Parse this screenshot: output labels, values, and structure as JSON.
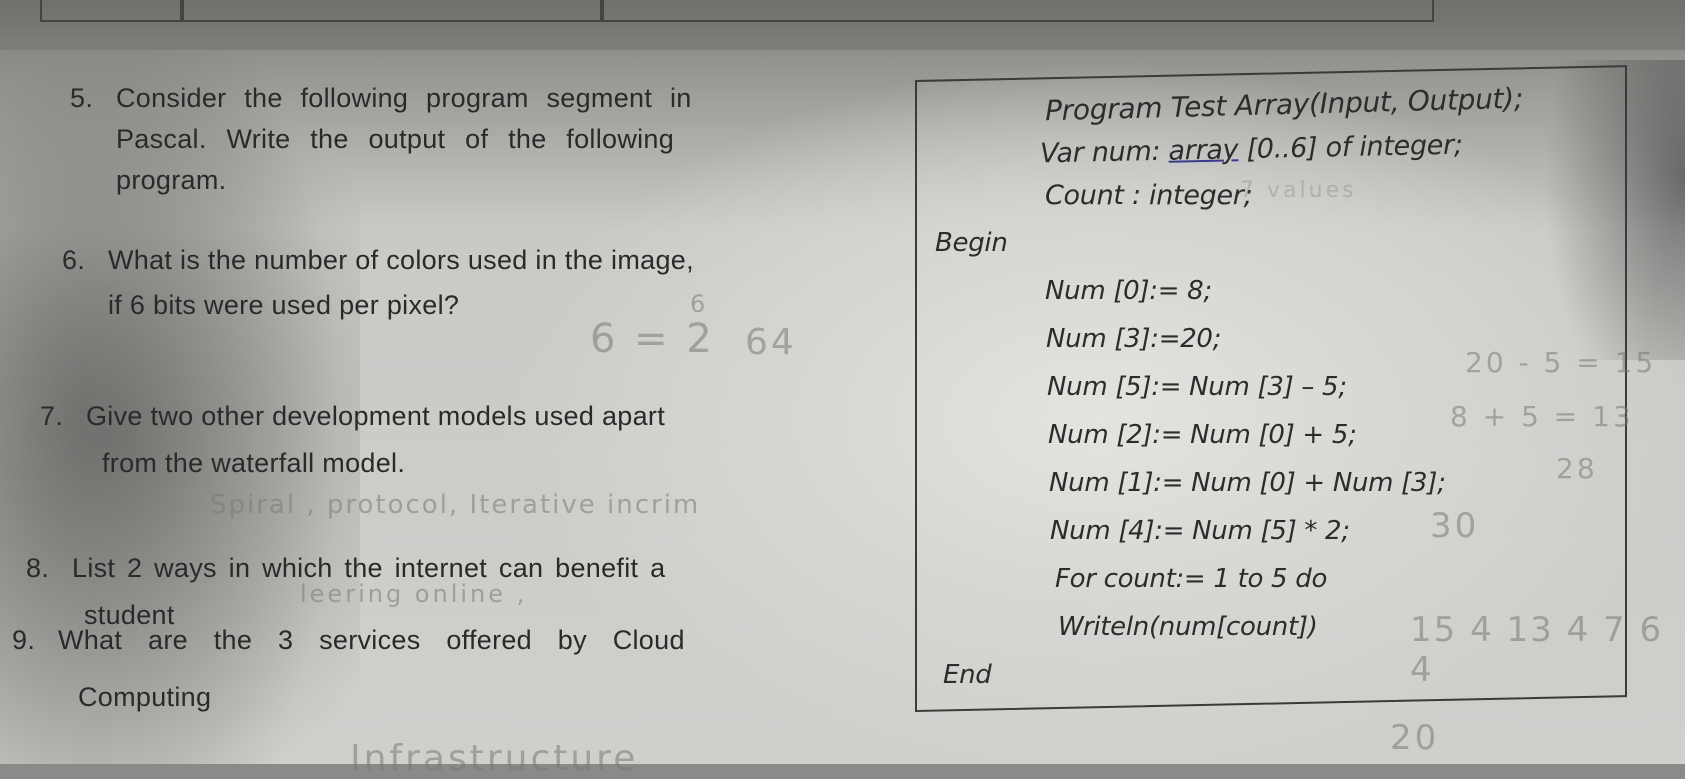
{
  "questions": [
    {
      "number": "5.",
      "lines": [
        "Consider the following program segment in",
        "Pascal. Write the output of the following",
        "program."
      ]
    },
    {
      "number": "6.",
      "lines": [
        "What is the number of colors used in the image,",
        "if 6 bits were used per pixel?"
      ]
    },
    {
      "number": "7.",
      "lines": [
        "Give two other development models used apart",
        "from the waterfall model."
      ]
    },
    {
      "number": "8.",
      "lines": [
        "List 2 ways in which the internet can benefit a",
        "student"
      ]
    },
    {
      "number": "9.",
      "lines": [
        "What are the 3 services offered by Cloud",
        "Computing"
      ]
    }
  ],
  "program": {
    "header": "Program Test Array(Input, Output);",
    "var_prefix": "Var num: ",
    "var_keyword": "array",
    "var_suffix": " [0..6] of integer;",
    "count_decl": "Count : integer;",
    "begin": "Begin",
    "statements": [
      "Num [0]:= 8;",
      "Num [3]:=20;",
      "Num [5]:= Num [3] – 5;",
      "Num [2]:= Num [0] + 5;",
      "Num [1]:= Num [0] + Num [3];",
      "Num [4]:= Num [5] * 2;",
      "For count:= 1 to 5 do",
      "Writeln(num[count])"
    ],
    "end": "End"
  },
  "handwritten_notes": {
    "q6_work": "6 = 2",
    "q6_exponent": "6",
    "q6_answer": "64",
    "q7_answer": "Spiral , protocol, Iterative incrim",
    "q8_answer": "leering online ,",
    "q9_answer": "Infrastructure",
    "calc_1": "20 - 5 = 15",
    "calc_2": "8 + 5 = 13",
    "calc_3": "28",
    "calc_4": "30",
    "output_line": "15 4 13 4 7 6 4",
    "stray_digits": "20",
    "var_scribble": "7 values"
  }
}
